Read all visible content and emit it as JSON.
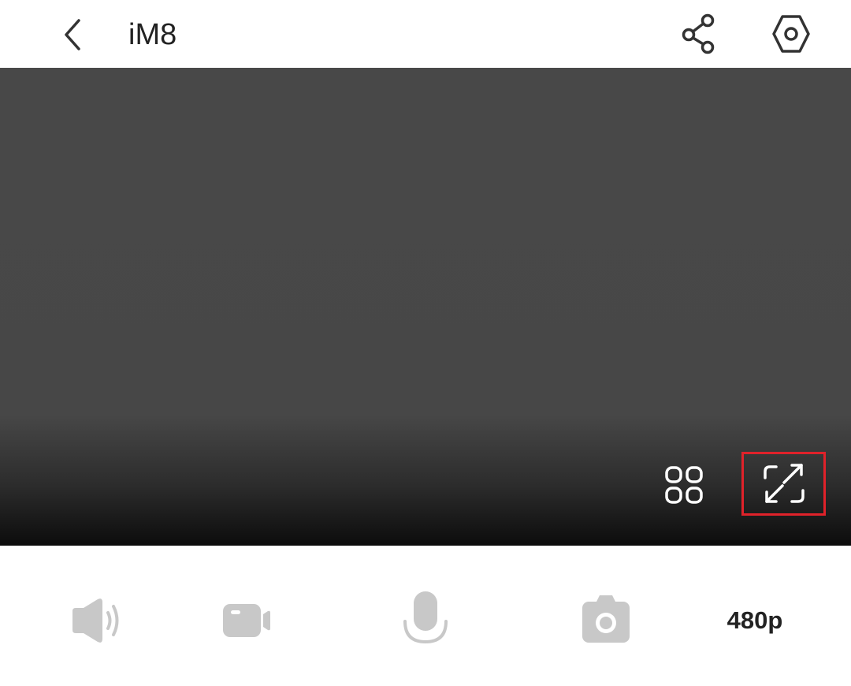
{
  "header": {
    "title": "iM8",
    "back_icon": "chevron-left-icon",
    "share_icon": "share-icon",
    "settings_icon": "hexagon-settings-icon"
  },
  "video": {
    "overlay": {
      "grid_icon": "grid-layout-icon",
      "fullscreen_icon": "fullscreen-icon",
      "highlight_color": "#e0222a"
    }
  },
  "controls": {
    "speaker_icon": "speaker-icon",
    "record_icon": "video-camera-icon",
    "mic_icon": "microphone-icon",
    "snapshot_icon": "camera-icon",
    "quality_label": "480p",
    "icon_color": "#c8c8c8"
  }
}
